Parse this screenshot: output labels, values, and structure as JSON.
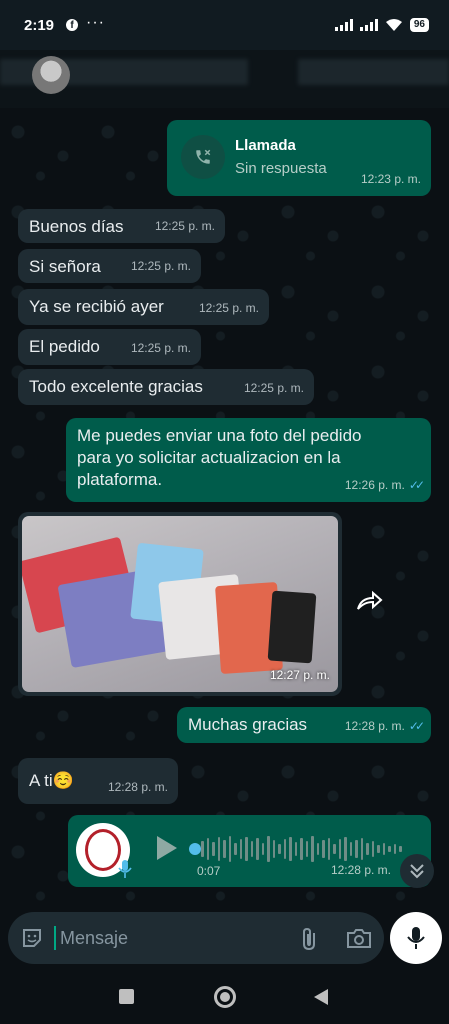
{
  "status_bar": {
    "time": "2:19",
    "facebook_icon_letter": "f",
    "more_dots": "···",
    "battery": "96"
  },
  "messages": [
    {
      "id": "call",
      "direction": "out",
      "kind": "call",
      "title": "Llamada",
      "subtitle": "Sin respuesta",
      "time": "12:23 p. m."
    },
    {
      "id": "m1",
      "direction": "in",
      "text": "Buenos días",
      "time": "12:25 p. m."
    },
    {
      "id": "m2",
      "direction": "in",
      "text": "Si señora",
      "time": "12:25 p. m."
    },
    {
      "id": "m3",
      "direction": "in",
      "text": "Ya se recibió ayer",
      "time": "12:25 p. m."
    },
    {
      "id": "m4",
      "direction": "in",
      "text": "El pedido",
      "time": "12:25 p. m."
    },
    {
      "id": "m5",
      "direction": "in",
      "text": "Todo excelente gracias",
      "time": "12:25 p. m."
    },
    {
      "id": "m6",
      "direction": "out",
      "lines": [
        "Me puedes enviar una foto del pedido",
        "para yo solicitar actualizacion en la",
        "plataforma."
      ],
      "time": "12:26 p. m.",
      "read_ticks": "✓✓"
    },
    {
      "id": "m7",
      "direction": "in",
      "kind": "image",
      "time": "12:27 p. m."
    },
    {
      "id": "m8",
      "direction": "out",
      "text": "Muchas gracias",
      "time": "12:28 p. m.",
      "read_ticks": "✓✓"
    },
    {
      "id": "m9",
      "direction": "in",
      "text": "A ti☺️",
      "time": "12:28 p. m."
    },
    {
      "id": "m10",
      "direction": "out",
      "kind": "audio",
      "duration": "0:07",
      "time": "12:28 p. m."
    }
  ],
  "input": {
    "placeholder": "Mensaje"
  },
  "colors": {
    "incoming_bubble": "#1f2c33",
    "outgoing_bubble": "#005c4b",
    "read_tick": "#53bdeb",
    "accent": "#00a884"
  },
  "icons": [
    "facebook-icon",
    "signal-icon",
    "wifi-icon",
    "battery-icon",
    "missed-call-icon",
    "forward-icon",
    "play-icon",
    "mic-icon",
    "scroll-down-icon",
    "sticker-icon",
    "attach-icon",
    "camera-icon",
    "recents-icon",
    "home-icon",
    "back-icon"
  ]
}
